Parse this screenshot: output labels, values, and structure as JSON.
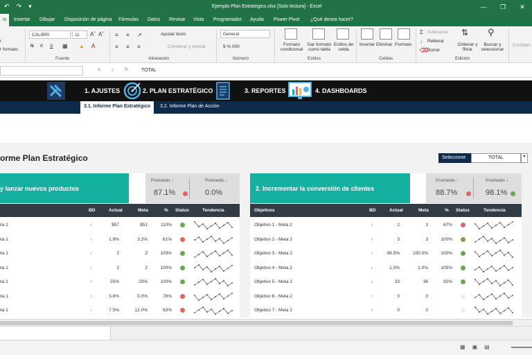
{
  "window": {
    "title": "Ejemplo Plan Estrategico.xlsx  [Solo lectura]  -  Excel",
    "controls": [
      "—",
      "❐",
      "✕"
    ]
  },
  "ribbon_tabs": [
    "io",
    "Insertar",
    "Dibujar",
    "Disposición de página",
    "Fórmulas",
    "Datos",
    "Revisar",
    "Vista",
    "Programador",
    "Ayuda",
    "Power Pivot",
    "¿Qué desea hacer?"
  ],
  "ribbon": {
    "clipboard": {
      "paste_label": "r",
      "format_label": "r formato"
    },
    "font": {
      "name": "CALIBRI",
      "size": "11",
      "bold": "N",
      "italic": "K",
      "underline": "S",
      "group_label": "Fuente"
    },
    "alignment": {
      "wrap": "Ajustar texto",
      "merge": "Combinar y centrar",
      "group_label": "Alineación"
    },
    "number": {
      "format": "General",
      "group_label": "Número",
      "symbols": "$  %  000"
    },
    "styles": {
      "conditional": "Formato condicional",
      "as_table": "Dar formato como tabla",
      "cell_styles": "Estilos de celda",
      "group_label": "Estilos"
    },
    "cells": {
      "insert": "Insertar",
      "delete": "Eliminar",
      "format": "Formato",
      "group_label": "Celdas"
    },
    "editing": {
      "autosum": "Autosuma",
      "fill": "Rellenar",
      "clear": "Borrar",
      "sort": "Ordenar y filtrar",
      "find": "Buscar y seleccionar",
      "group_label": "Edición"
    },
    "confidential": "Confiden"
  },
  "formula_bar": {
    "cancel": "✕",
    "enter": "✓",
    "fx": "fx",
    "content": "TOTAL"
  },
  "nav": {
    "items": [
      {
        "label": "1. AJUSTES"
      },
      {
        "label": "2. PLAN ESTRATÉGICO"
      },
      {
        "label": "3. REPORTES"
      },
      {
        "label": "4. DASHBOARDS"
      }
    ],
    "subtabs": [
      "3.1. Informe Plan Estratégico",
      "3.2. Informe Plan de Acción"
    ]
  },
  "report": {
    "title": "orme Plan Estratégico",
    "selector_label": "Seleccione",
    "selector_value": "TOTAL"
  },
  "panels": [
    {
      "goal": "y lanzar nuevos productos",
      "avg_up_label": "Promedio ↑",
      "avg_up_value": "87.1%",
      "avg_up_status": "#e06666",
      "avg_down_label": "Promedio ↓",
      "avg_down_value": "0.0%",
      "columns": [
        "BD",
        "Actual",
        "Meta",
        "%",
        "Status",
        "Tendencia"
      ],
      "rows": [
        {
          "obj": "Meta 1",
          "bd": "↑",
          "actual": "$57",
          "meta": "$51",
          "pct": "110%",
          "status": "#6aa84f"
        },
        {
          "obj": "Meta 1",
          "bd": "↑",
          "actual": "1.9%",
          "meta": "3.2%",
          "pct": "61%",
          "status": "#e06666"
        },
        {
          "obj": "Meta 1",
          "bd": "↑",
          "actual": "2",
          "meta": "2",
          "pct": "100%",
          "status": "#6aa84f"
        },
        {
          "obj": "Meta 1",
          "bd": "↑",
          "actual": "2",
          "meta": "2",
          "pct": "100%",
          "status": "#6aa84f"
        },
        {
          "obj": "Meta 1",
          "bd": "↑",
          "actual": "25%",
          "meta": "25%",
          "pct": "100%",
          "status": "#6aa84f"
        },
        {
          "obj": "Meta 1",
          "bd": "↑",
          "actual": "3.8%",
          "meta": "5.0%",
          "pct": "76%",
          "status": "#e06666"
        },
        {
          "obj": "Meta 1",
          "bd": "↑",
          "actual": "7.5%",
          "meta": "12.0%",
          "pct": "63%",
          "status": "#e06666"
        }
      ]
    },
    {
      "goal": "2. Incrementar la conversión de clientes",
      "avg_up_label": "Promedio ↑",
      "avg_up_value": "88.7%",
      "avg_up_status": "#e06666",
      "avg_down_label": "Promedio ↓",
      "avg_down_value": "98.1%",
      "avg_down_status": "#6aa84f",
      "columns": [
        "Objetivos",
        "BD",
        "Actual",
        "Meta",
        "%",
        "Status",
        "Tendencia"
      ],
      "rows": [
        {
          "obj": "Objetivo 1 - Meta 2",
          "bd": "↑",
          "actual": "2",
          "meta": "3",
          "pct": "67%",
          "status": "#e06666"
        },
        {
          "obj": "Objetivo 2 - Meta 2",
          "bd": "↑",
          "actual": "3",
          "meta": "3",
          "pct": "100%",
          "status": "#6aa84f"
        },
        {
          "obj": "Objetivo 3 - Meta 2",
          "bd": "↑",
          "actual": "99.5%",
          "meta": "100.0%",
          "pct": "100%",
          "status": "#6aa84f"
        },
        {
          "obj": "Objetivo 4 - Meta 2",
          "bd": "↓",
          "actual": "1.0%",
          "meta": "1.0%",
          "pct": "105%",
          "status": "#6aa84f"
        },
        {
          "obj": "Objetivo 5 - Meta 2",
          "bd": "↓",
          "actual": "33",
          "meta": "36",
          "pct": "92%",
          "status": "#6aa84f"
        },
        {
          "obj": "Objetivo 6 - Meta 2",
          "bd": "↑",
          "actual": "0",
          "meta": "0",
          "pct": "",
          "status": "#eeeeee"
        },
        {
          "obj": "Objetivo 7 - Meta 2",
          "bd": "↑",
          "actual": "0",
          "meta": "0",
          "pct": "",
          "status": "#eeeeee"
        }
      ]
    }
  ],
  "colors": {
    "excel_green": "#217346",
    "teal": "#14b1a0",
    "navy": "#0d2a4a",
    "header": "#333c45",
    "good": "#6aa84f",
    "bad": "#e06666"
  },
  "icons": [
    "undo-icon",
    "redo-icon",
    "wrench-icon",
    "target-icon",
    "report-icon",
    "dashboard-icon"
  ]
}
